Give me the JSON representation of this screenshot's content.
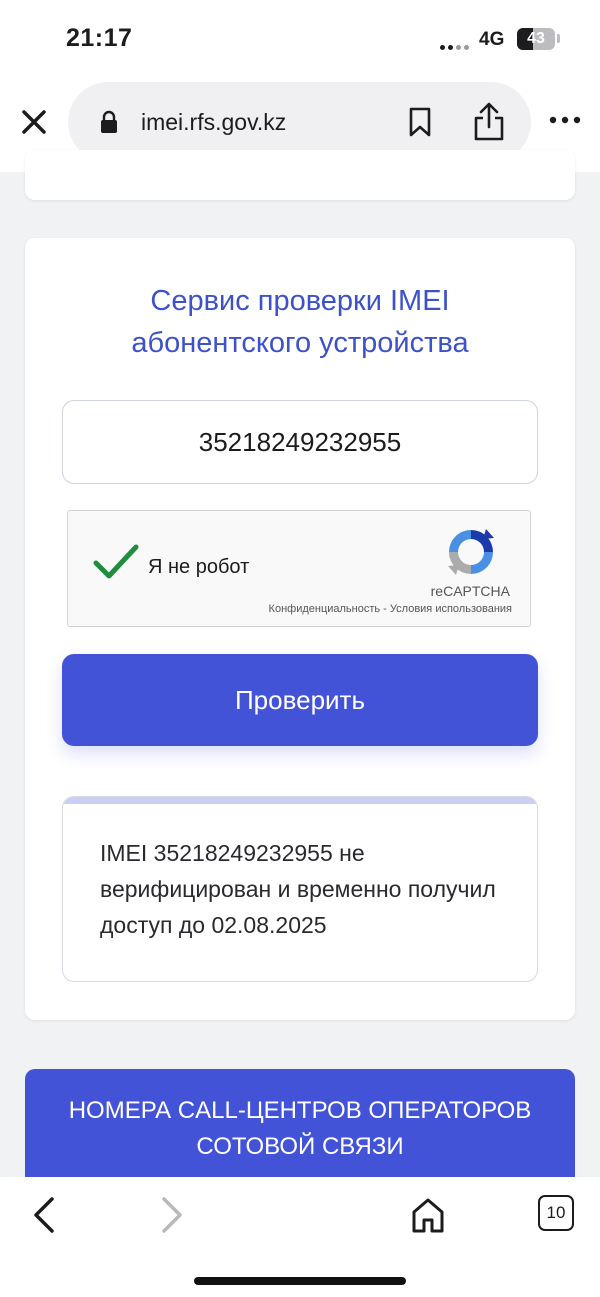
{
  "status_bar": {
    "time": "21:17",
    "network": "4G",
    "battery_level": "43",
    "battery_fraction": 0.43
  },
  "browser": {
    "url": "imei.rfs.gov.kz",
    "icons": {
      "close": "close-icon",
      "lock": "lock-icon",
      "bookmark": "bookmark-icon",
      "share": "share-icon",
      "more": "more-icon"
    }
  },
  "page": {
    "service_title_line1": "Сервис проверки IMEI",
    "service_title_line2": "абонентского устройства",
    "imei_value": "35218249232955",
    "captcha": {
      "label": "Я не робот",
      "brand": "reCAPTCHA",
      "links": "Конфиденциальность - Условия использования",
      "checked": true
    },
    "check_button": "Проверить",
    "result_text": "IMEI 35218249232955 не верифицирован и временно получил доступ до 02.08.2025",
    "callcenter_line1": "НОМЕРА CALL-ЦЕНТРОВ ОПЕРАТОРОВ",
    "callcenter_line2": "СОТОВОЙ СВЯЗИ"
  },
  "toolbar": {
    "tabs_count": "10",
    "icons": {
      "back": "back-icon",
      "forward": "forward-icon",
      "home": "home-icon",
      "tabs": "tabs-icon"
    }
  },
  "colors": {
    "accent": "#4353d8",
    "title": "#3d52c8",
    "result_bar": "#cbcff5",
    "captcha_check": "#1e8e3e"
  }
}
